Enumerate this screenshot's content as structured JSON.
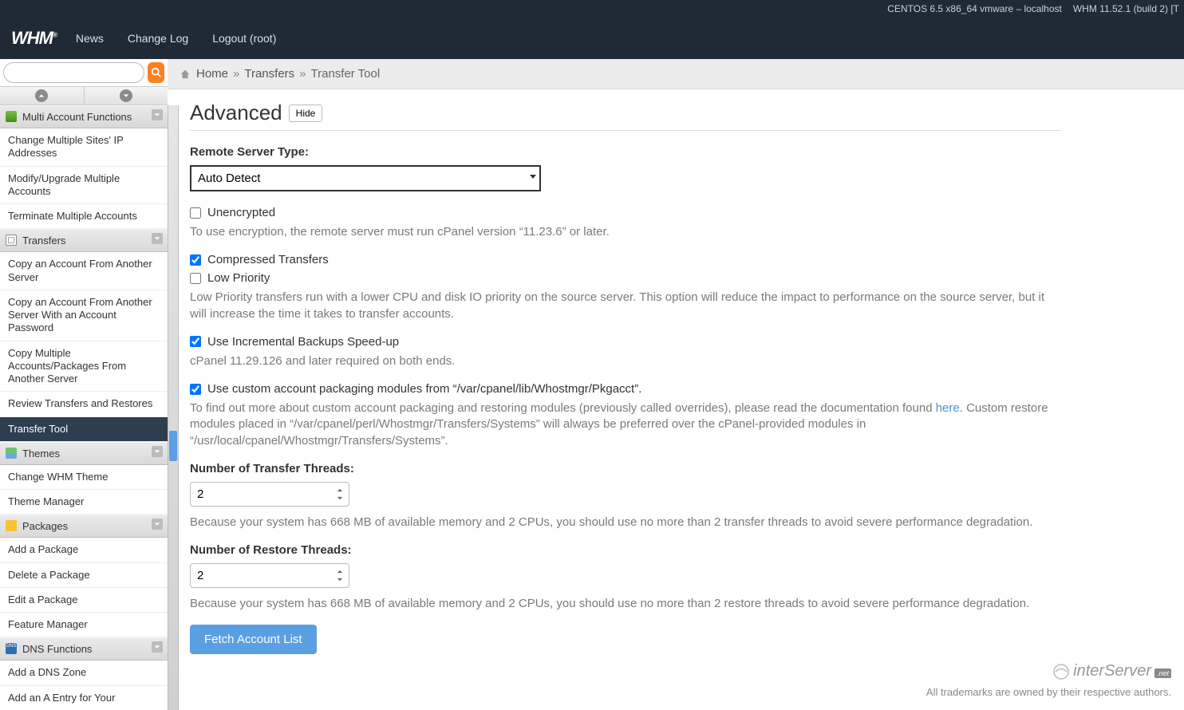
{
  "topbar": {
    "os": "CENTOS 6.5 x86_64 vmware – localhost",
    "version": "WHM 11.52.1 (build 2) [T"
  },
  "header": {
    "logo": "WHM",
    "links": {
      "news": "News",
      "changelog": "Change Log",
      "logout": "Logout (root)"
    }
  },
  "search": {
    "placeholder": ""
  },
  "breadcrumb": {
    "home": "Home",
    "transfers": "Transfers",
    "current": "Transfer Tool"
  },
  "sidebar": {
    "groups": [
      {
        "key": "multi",
        "label": "Multi Account Functions",
        "items": [
          "Change Multiple Sites' IP Addresses",
          "Modify/Upgrade Multiple Accounts",
          "Terminate Multiple Accounts"
        ]
      },
      {
        "key": "transfers",
        "label": "Transfers",
        "items": [
          "Copy an Account From Another Server",
          "Copy an Account From Another Server With an Account Password",
          "Copy Multiple Accounts/Packages From Another Server",
          "Review Transfers and Restores",
          "Transfer Tool"
        ],
        "active_index": 4
      },
      {
        "key": "themes",
        "label": "Themes",
        "items": [
          "Change WHM Theme",
          "Theme Manager"
        ]
      },
      {
        "key": "packages",
        "label": "Packages",
        "items": [
          "Add a Package",
          "Delete a Package",
          "Edit a Package",
          "Feature Manager"
        ]
      },
      {
        "key": "dns",
        "label": "DNS Functions",
        "items": [
          "Add a DNS Zone",
          "Add an A Entry for Your"
        ]
      }
    ]
  },
  "advanced": {
    "title": "Advanced",
    "hide": "Hide",
    "remote_label": "Remote Server Type:",
    "remote_value": "Auto Detect",
    "unencrypted_label": "Unencrypted",
    "unencrypted_help": "To use encryption, the remote server must run cPanel version “11.23.6” or later.",
    "compressed_label": "Compressed Transfers",
    "lowpriority_label": "Low Priority",
    "lowpriority_help": "Low Priority transfers run with a lower CPU and disk IO priority on the source server. This option will reduce the impact to performance on the source server, but it will increase the time it takes to transfer accounts.",
    "incremental_label": "Use Incremental Backups Speed-up",
    "incremental_help": "cPanel 11.29.126 and later required on both ends.",
    "custom_label": "Use custom account packaging modules from “/var/cpanel/lib/Whostmgr/Pkgacct”.",
    "custom_help_1": "To find out more about custom account packaging and restoring modules (previously called overrides), please read the documentation found ",
    "custom_help_link": "here",
    "custom_help_2": ". Custom restore modules placed in “/var/cpanel/perl/Whostmgr/Transfers/Systems” will always be preferred over the cPanel-provided modules in “/usr/local/cpanel/Whostmgr/Transfers/Systems”.",
    "transfer_threads_label": "Number of Transfer Threads:",
    "transfer_threads_value": "2",
    "transfer_threads_help": "Because your system has 668 MB of available memory and 2 CPUs, you should use no more than 2 transfer threads to avoid severe performance degradation.",
    "restore_threads_label": "Number of Restore Threads:",
    "restore_threads_value": "2",
    "restore_threads_help": "Because your system has 668 MB of available memory and 2 CPUs, you should use no more than 2 restore threads to avoid severe performance degradation.",
    "fetch_btn": "Fetch Account List"
  },
  "footer": {
    "brand": "interServer",
    "net": ".net",
    "trademark": "All trademarks are owned by their respective authors."
  }
}
